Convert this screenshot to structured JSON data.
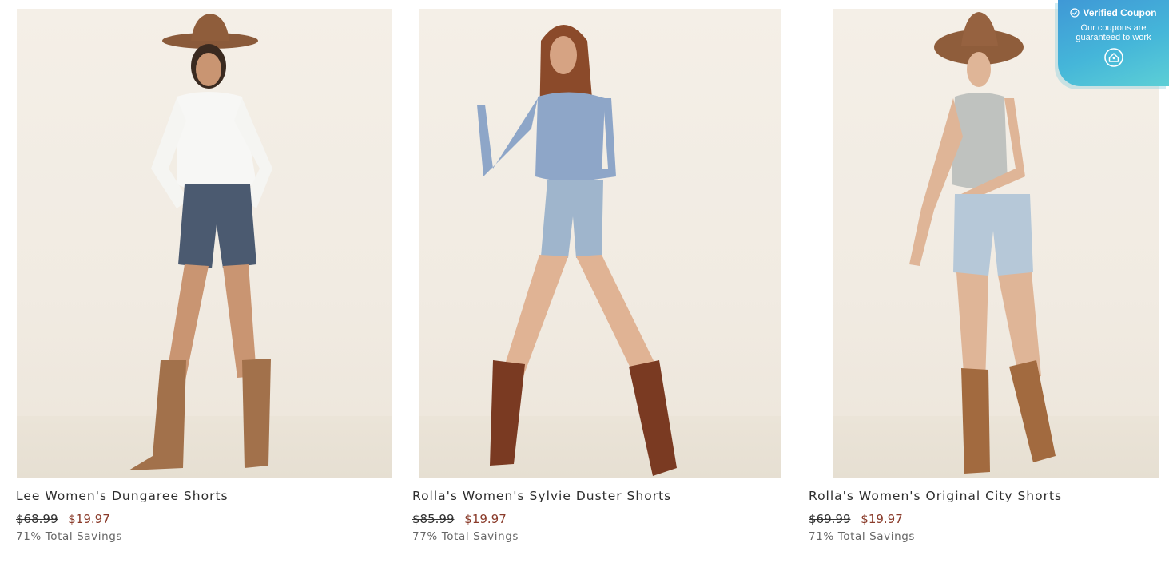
{
  "products": [
    {
      "title": "Lee Women's Dungaree Shorts",
      "original_price": "$68.99",
      "sale_price": "$19.97",
      "savings": "71% Total Savings",
      "image_alt": "lee-dungaree-shorts-photo"
    },
    {
      "title": "Rolla's Women's Sylvie Duster Shorts",
      "original_price": "$85.99",
      "sale_price": "$19.97",
      "savings": "77% Total Savings",
      "image_alt": "rollas-sylvie-duster-shorts-photo"
    },
    {
      "title": "Rolla's Women's Original City Shorts",
      "original_price": "$69.99",
      "sale_price": "$19.97",
      "savings": "71% Total Savings",
      "image_alt": "rollas-original-city-shorts-photo"
    }
  ],
  "coupon_widget": {
    "heading": "Verified Coupon",
    "message": "Our coupons are guaranteed to work",
    "icons": [
      "check-circle-icon",
      "coupon-logo-icon"
    ]
  },
  "colors": {
    "sale_price": "#8a3b2a",
    "coupon_gradient_start": "#3f98d6",
    "coupon_gradient_end": "#5ccfd6",
    "photo_background": "#f2ece3"
  }
}
